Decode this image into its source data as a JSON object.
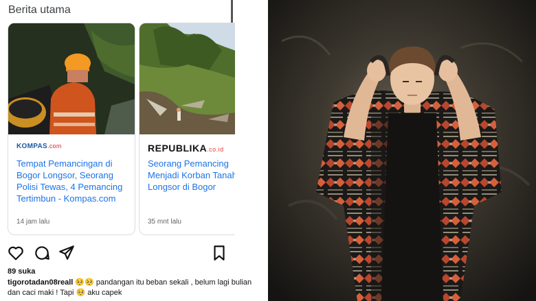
{
  "section_title": "Berita utama",
  "cards": [
    {
      "publisher_main": "KOMPAS",
      "publisher_suffix": ".com",
      "headline": "Tempat Pemancingan di Bogor Longsor, Seorang Polisi Tewas, 4 Pemancing Tertimbun - Kompas.com",
      "time": "14 jam lalu"
    },
    {
      "publisher_main": "REPUBLIKA",
      "publisher_suffix": ".co.id",
      "headline_line1": "Seorang Pemancing",
      "headline_line2": "Menjadi Korban Tanah",
      "headline_line3": "Longsor di Bogor",
      "time": "35 mnt lalu"
    }
  ],
  "post": {
    "likes": "89 suka",
    "username": "tigorotadan08reall",
    "emoji1": "🥺🥺",
    "caption_part1": " pandangan itu beban sekali , belum lagi bulian dan caci maki ! Tapi ",
    "emoji2": "🥺",
    "caption_part2": " aku capek"
  },
  "icons": {
    "like": "heart-icon",
    "comment": "comment-icon",
    "share": "send-icon",
    "save": "bookmark-icon"
  },
  "colors": {
    "link_blue": "#1a73e8",
    "kompas_blue": "#1a5aa0",
    "republika_red": "#e63a2e"
  }
}
